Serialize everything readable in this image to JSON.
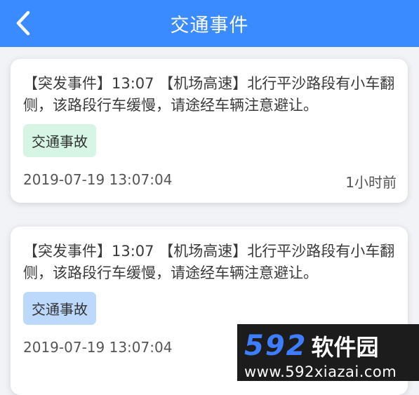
{
  "header": {
    "title": "交通事件",
    "back_icon": "chevron-left-icon",
    "bg_color": "#3a8bff"
  },
  "events": [
    {
      "text": "【突发事件】13:07 【机场高速】北行平沙路段有小车翻侧，该路段行车缓慢，请途经车辆注意避让。",
      "tag": "交通事故",
      "tag_color": "#d6f5e4",
      "time": "2019-07-19 13:07:04",
      "ago": "1小时前"
    },
    {
      "text": "【突发事件】13:07 【机场高速】北行平沙路段有小车翻侧，该路段行车缓慢，请途经车辆注意避让。",
      "tag": "交通事故",
      "tag_color": "#bcd9fb",
      "time": "2019-07-19 13:07:04",
      "ago": ""
    }
  ],
  "watermark": {
    "number": "592",
    "name": "软件园",
    "url": "www.592xiazai.com"
  }
}
